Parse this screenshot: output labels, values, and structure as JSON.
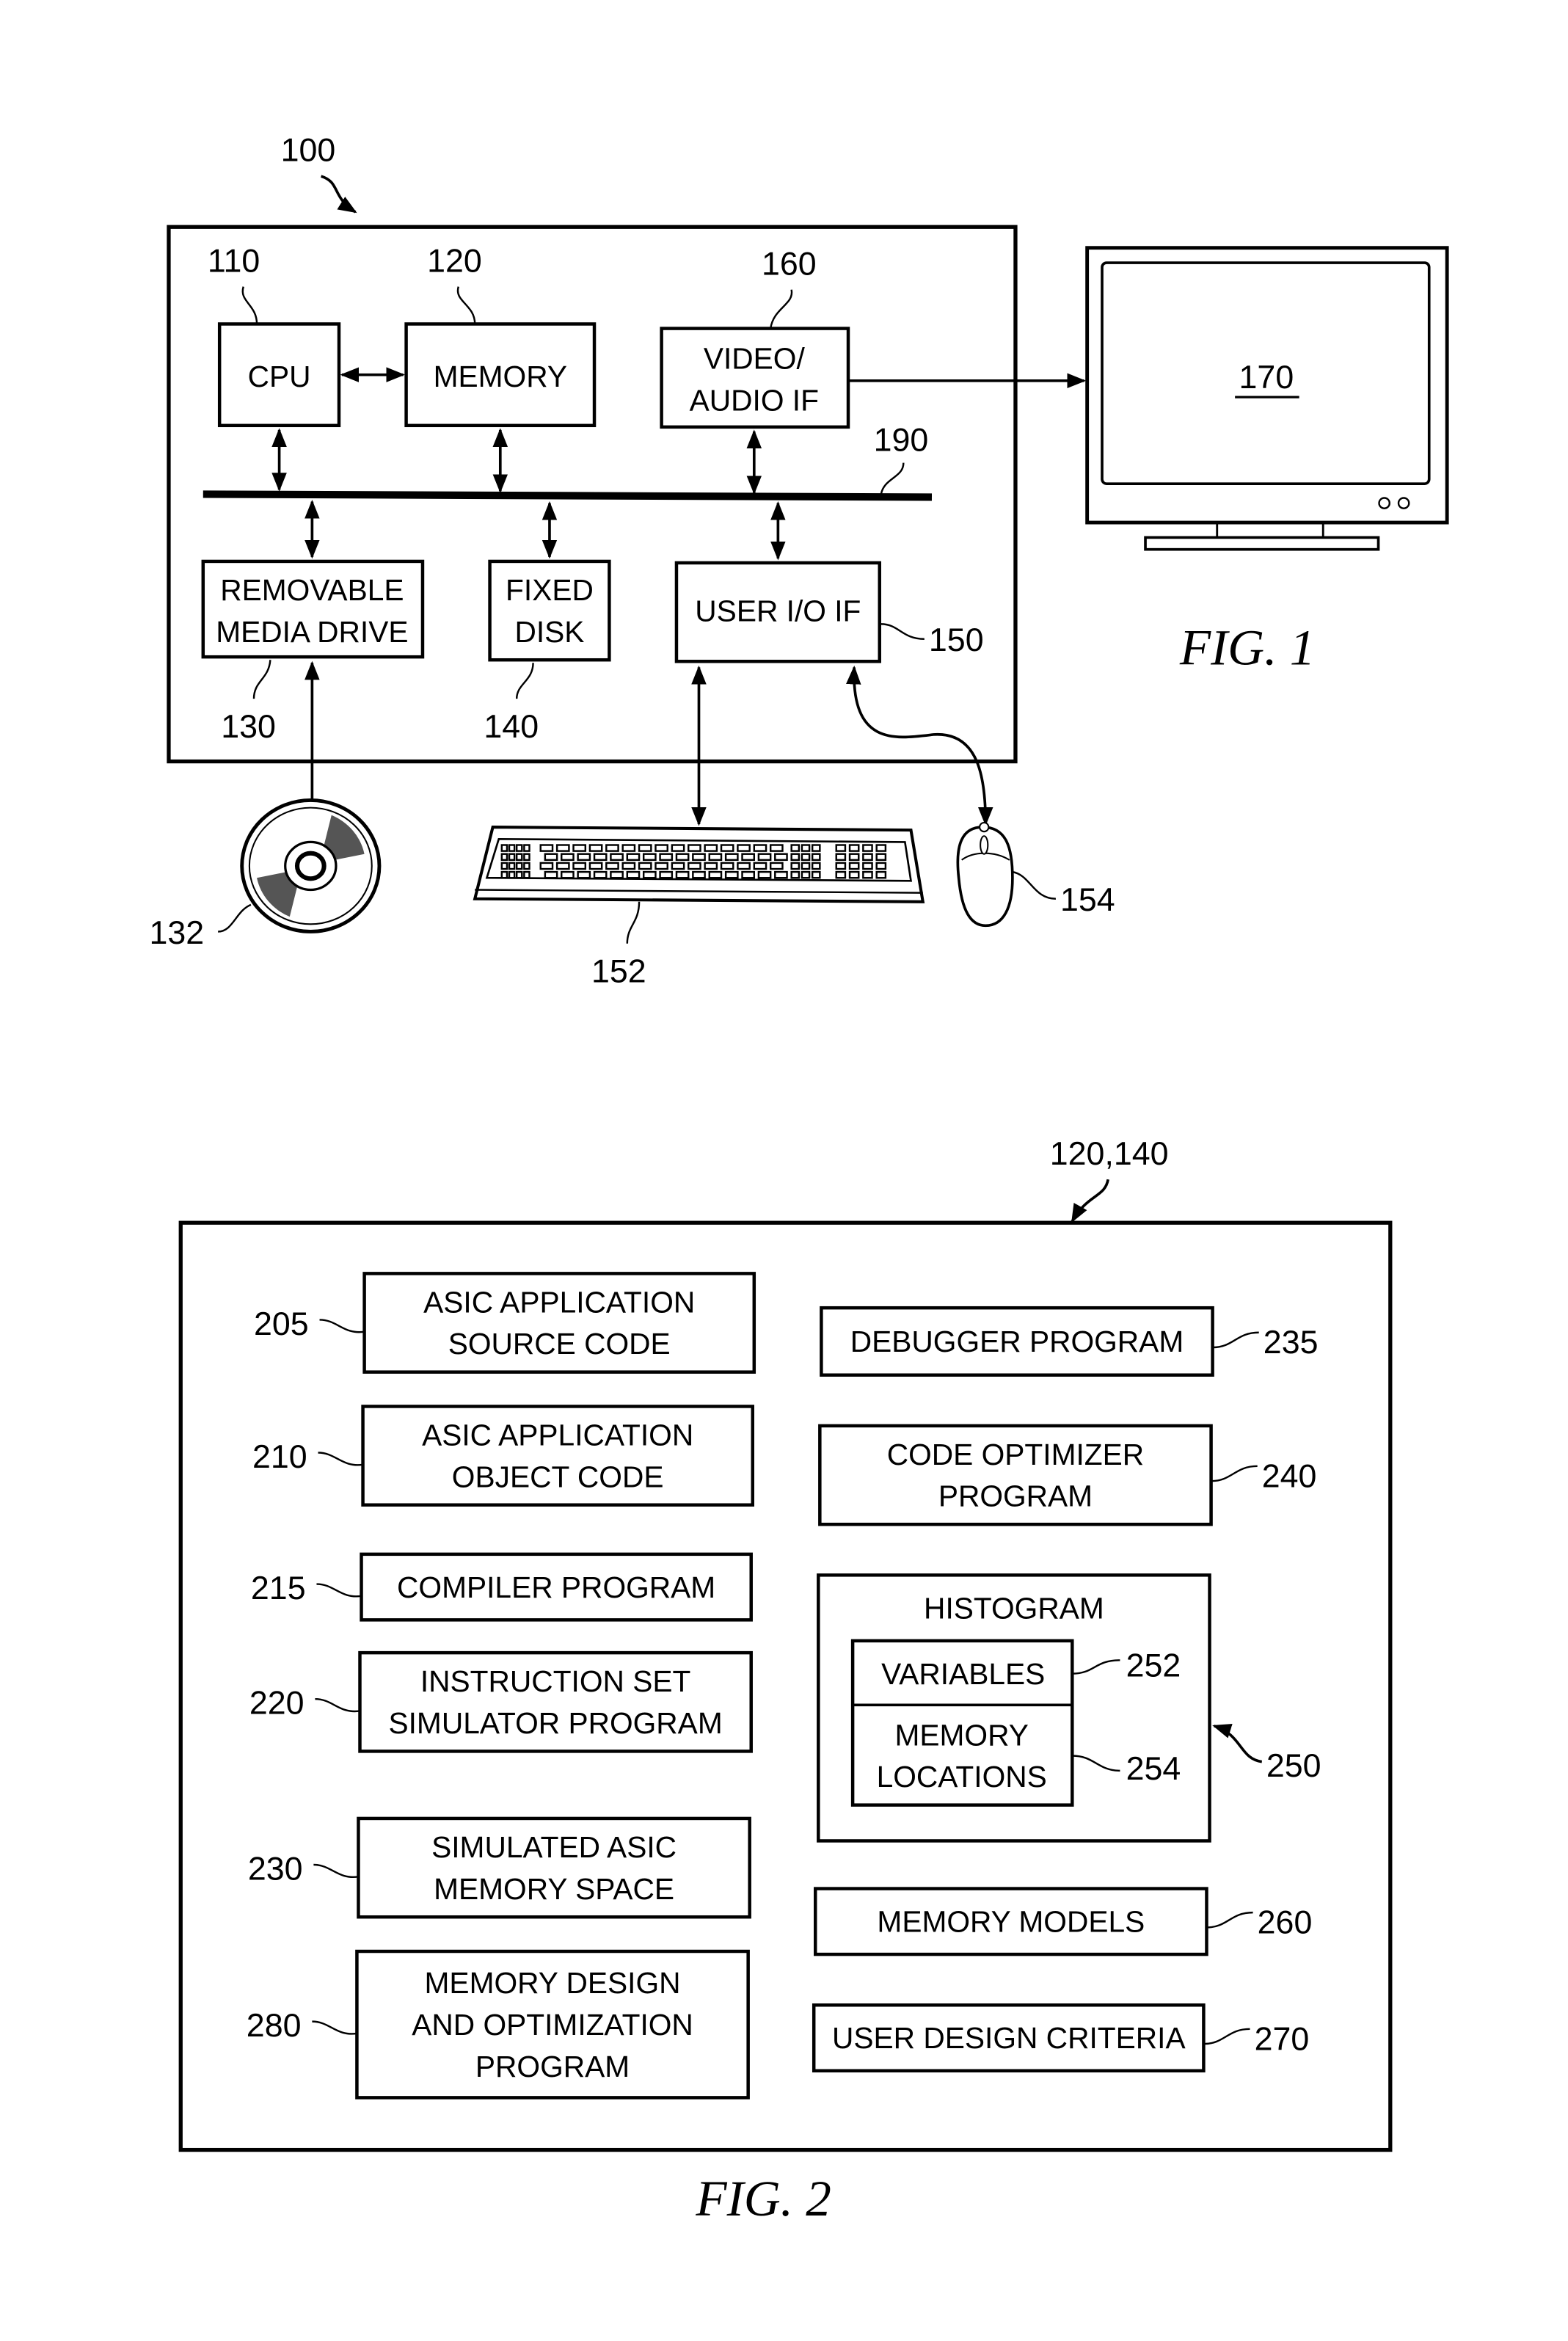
{
  "fig1": {
    "caption": "FIG. 1",
    "system_ref": "100",
    "bus_ref": "190",
    "blocks": {
      "cpu": {
        "label": "CPU",
        "ref": "110"
      },
      "memory": {
        "label": "MEMORY",
        "ref": "120"
      },
      "video": {
        "lines": [
          "VIDEO/",
          "AUDIO IF"
        ],
        "ref": "160"
      },
      "removable": {
        "lines": [
          "REMOVABLE",
          "MEDIA DRIVE"
        ],
        "ref": "130"
      },
      "fixed_disk": {
        "lines": [
          "FIXED",
          "DISK"
        ],
        "ref": "140"
      },
      "user_io": {
        "label": "USER I/O IF",
        "ref": "150"
      }
    },
    "monitor": {
      "ref": "170"
    },
    "disc": {
      "ref": "132"
    },
    "keyboard": {
      "ref": "152"
    },
    "mouse": {
      "ref": "154"
    }
  },
  "fig2": {
    "caption": "FIG. 2",
    "container_ref": "120,140",
    "left_blocks": [
      {
        "ref": "205",
        "lines": [
          "ASIC APPLICATION",
          "SOURCE CODE"
        ]
      },
      {
        "ref": "210",
        "lines": [
          "ASIC APPLICATION",
          "OBJECT CODE"
        ]
      },
      {
        "ref": "215",
        "lines": [
          "COMPILER PROGRAM"
        ]
      },
      {
        "ref": "220",
        "lines": [
          "INSTRUCTION SET",
          "SIMULATOR PROGRAM"
        ]
      },
      {
        "ref": "230",
        "lines": [
          "SIMULATED ASIC",
          "MEMORY SPACE"
        ]
      },
      {
        "ref": "280",
        "lines": [
          "MEMORY DESIGN",
          "AND OPTIMIZATION",
          "PROGRAM"
        ]
      }
    ],
    "right_blocks": [
      {
        "ref": "235",
        "lines": [
          "DEBUGGER PROGRAM"
        ]
      },
      {
        "ref": "240",
        "lines": [
          "CODE OPTIMIZER",
          "PROGRAM"
        ]
      },
      {
        "ref": "260",
        "lines": [
          "MEMORY MODELS"
        ]
      },
      {
        "ref": "270",
        "lines": [
          "USER DESIGN CRITERIA"
        ]
      }
    ],
    "histogram": {
      "title": "HISTOGRAM",
      "ref": "250",
      "variables": {
        "label": "VARIABLES",
        "ref": "252"
      },
      "memory_locations": {
        "lines": [
          "MEMORY",
          "LOCATIONS"
        ],
        "ref": "254"
      }
    }
  }
}
